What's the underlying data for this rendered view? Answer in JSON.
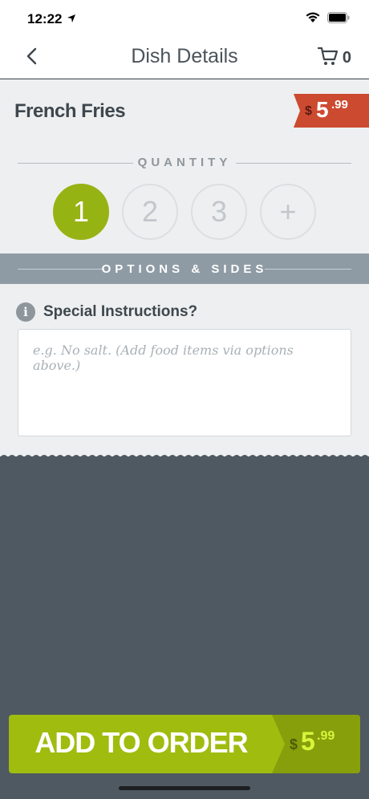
{
  "status": {
    "time": "12:22"
  },
  "nav": {
    "title": "Dish Details",
    "cart_count": "0"
  },
  "dish": {
    "name": "French Fries",
    "price_currency": "$",
    "price_main": "5",
    "price_cents": ".99"
  },
  "quantity": {
    "label": "QUANTITY",
    "options": [
      "1",
      "2",
      "3",
      "+"
    ],
    "selected": "1"
  },
  "options": {
    "label": "OPTIONS & SIDES"
  },
  "instructions": {
    "label": "Special Instructions?",
    "placeholder": "e.g. No salt. (Add food items via options above.)"
  },
  "footer": {
    "add_label": "ADD TO ORDER",
    "price_currency": "$",
    "price_main": "5",
    "price_cents": ".99"
  },
  "colors": {
    "accent_green": "#a0bc0f",
    "price_red": "#cc4a30",
    "dark_bg": "#4f5961",
    "options_bar": "#8f9ba4"
  }
}
